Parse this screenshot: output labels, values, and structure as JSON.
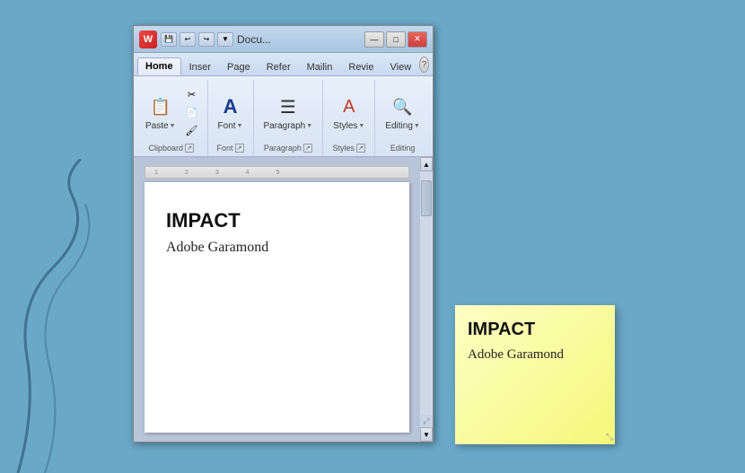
{
  "background_color": "#6aa8c8",
  "window": {
    "title": "Docu...",
    "icon_label": "W",
    "quick_access": [
      "save",
      "undo",
      "redo",
      "dropdown"
    ],
    "tabs": [
      {
        "label": "Home",
        "active": true
      },
      {
        "label": "Inser"
      },
      {
        "label": "Page"
      },
      {
        "label": "Refer"
      },
      {
        "label": "Mailin"
      },
      {
        "label": "Revie"
      },
      {
        "label": "View"
      }
    ],
    "controls": [
      "minimize",
      "maximize",
      "close"
    ],
    "ribbon": {
      "groups": [
        {
          "name": "Clipboard",
          "label": "Clipboard",
          "has_expand": true,
          "buttons": [
            {
              "icon": "📋",
              "label": "Paste",
              "has_arrow": true,
              "large": true
            },
            {
              "icon": "✂",
              "label": "",
              "small": true
            },
            {
              "icon": "📄",
              "label": "",
              "small": true
            },
            {
              "icon": "🖌",
              "label": "",
              "small": true
            }
          ]
        },
        {
          "name": "Font",
          "label": "Font",
          "has_expand": true,
          "buttons": [
            {
              "icon": "A",
              "label": "Font",
              "has_arrow": true
            }
          ]
        },
        {
          "name": "Paragraph",
          "label": "Paragraph",
          "has_expand": true,
          "buttons": [
            {
              "icon": "☰",
              "label": "Paragraph",
              "has_arrow": true
            }
          ]
        },
        {
          "name": "Styles",
          "label": "Styles",
          "has_expand": true,
          "buttons": [
            {
              "icon": "A",
              "label": "Styles",
              "has_arrow": true
            }
          ]
        },
        {
          "name": "Editing",
          "label": "Editing",
          "buttons": [
            {
              "icon": "🔍",
              "label": "Editing",
              "has_arrow": true
            }
          ]
        }
      ]
    },
    "document": {
      "text_impact": "IMPACT",
      "text_garamond": "Adobe Garamond"
    }
  },
  "sticky_note": {
    "text_impact": "IMPACT",
    "text_garamond": "Adobe Garamond"
  }
}
